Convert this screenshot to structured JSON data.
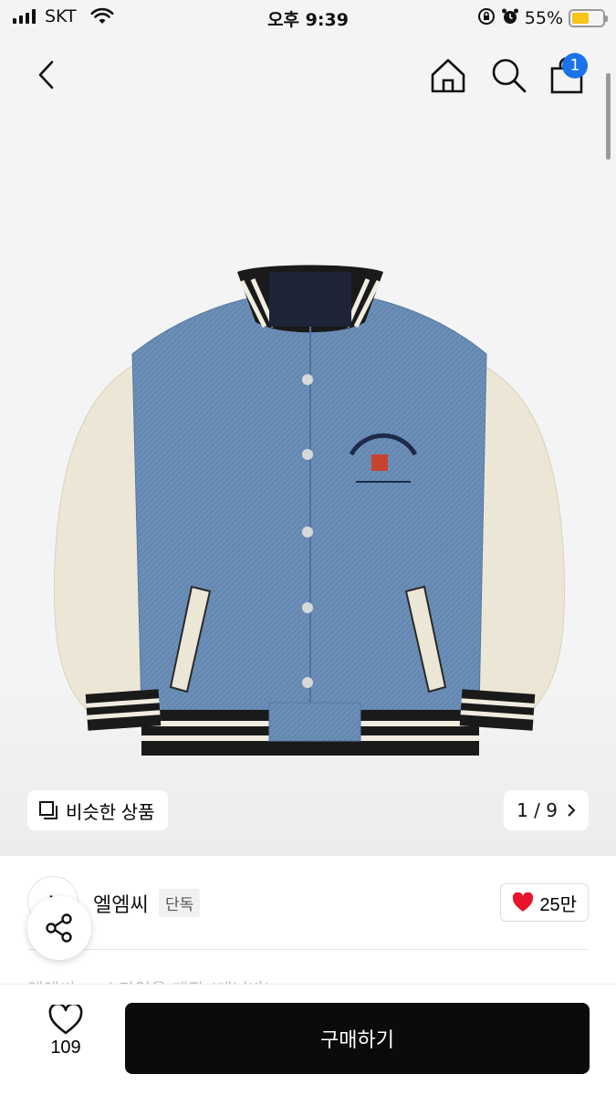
{
  "status_bar": {
    "carrier": "SKT",
    "time": "오후 9:39",
    "battery_percent": "55%",
    "battery_level": 0.55,
    "icons": [
      "signal-icon",
      "wifi-icon",
      "rotation-lock-icon",
      "alarm-icon",
      "battery-icon"
    ]
  },
  "header": {
    "cart_count": "1",
    "icons": [
      "back-arrow-icon",
      "home-icon",
      "search-icon",
      "shopping-bag-icon"
    ]
  },
  "gallery": {
    "similar_label": "비슷한 상품",
    "page_indicator": "1 / 9",
    "image_alt": "denim varsity jacket"
  },
  "product": {
    "brand_name": "엘엠씨",
    "exclusive_badge": "단독",
    "likes": "25만",
    "brand_logo_text": "L",
    "peek_text": "엘엠씨 ... 스타일을 제작 (데님바)"
  },
  "bottom_bar": {
    "wish_count": "109",
    "buy_label": "구매하기"
  },
  "colors": {
    "accent": "#0b0b0b",
    "badge_blue": "#1a73e8",
    "heart_red": "#e8142b",
    "battery_yellow": "#f5c518"
  }
}
